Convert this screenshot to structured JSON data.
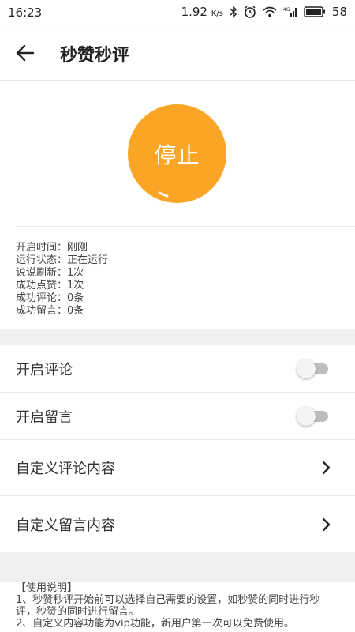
{
  "status_bar": {
    "time": "16:23",
    "net_speed": "1.92",
    "net_unit": "K/s",
    "battery": "58"
  },
  "header": {
    "title": "秒赞秒评"
  },
  "main": {
    "stop_button_label": "停止",
    "info": [
      {
        "label": "开启时间：",
        "value": "刚刚"
      },
      {
        "label": "运行状态：",
        "value": "正在运行"
      },
      {
        "label": "说说刷新：",
        "value": "1次"
      },
      {
        "label": "成功点赞：",
        "value": "1次"
      },
      {
        "label": "成功评论：",
        "value": "0条"
      },
      {
        "label": "成功留言：",
        "value": "0条"
      }
    ]
  },
  "settings": {
    "enable_comment": {
      "label": "开启评论",
      "on": false
    },
    "enable_message": {
      "label": "开启留言",
      "on": false
    },
    "custom_comment": {
      "label": "自定义评论内容"
    },
    "custom_message": {
      "label": "自定义留言内容"
    }
  },
  "notes": {
    "title": "【使用说明】",
    "line1": "1、秒赞秒评开始前可以选择自己需要的设置，如秒赞的同时进行秒评，秒赞的同时进行留言。",
    "line2": "2、自定义内容功能为vip功能，新用户第一次可以免费使用。"
  },
  "colors": {
    "accent": "#faa526",
    "toggle_off": "#bdbdbd",
    "divider_gray": "#f0f0f0"
  }
}
